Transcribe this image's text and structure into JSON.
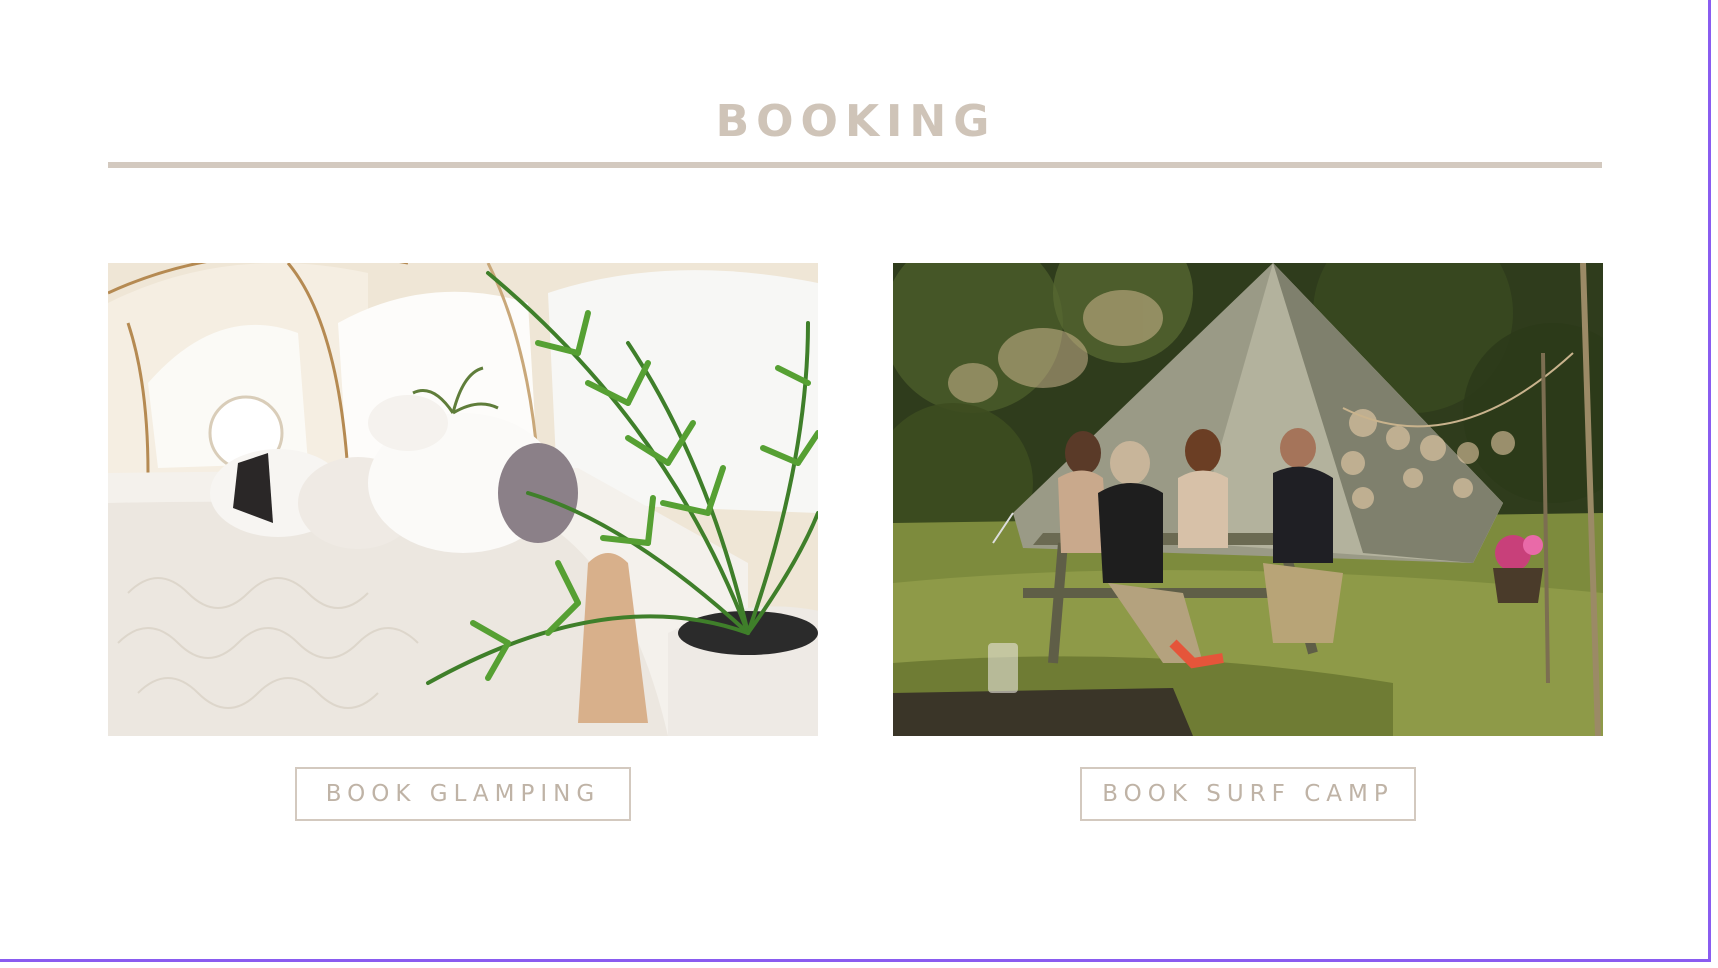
{
  "section": {
    "title": "BOOKING"
  },
  "cards": [
    {
      "button_label": "BOOK GLAMPING"
    },
    {
      "button_label": "BOOK SURF CAMP"
    }
  ],
  "colors": {
    "title": "#cfc4b8",
    "rule": "#d3c9bf",
    "button_border": "#d3c9bf",
    "button_text": "#bfb3a6",
    "frame": "#8a5cf0"
  }
}
